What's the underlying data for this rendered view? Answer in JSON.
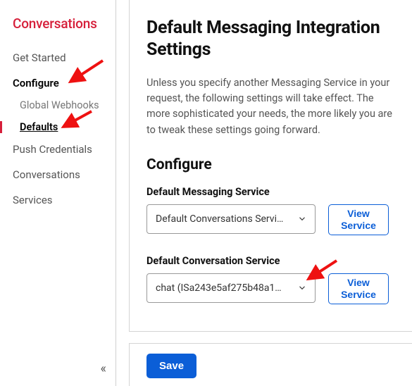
{
  "sidebar": {
    "title": "Conversations",
    "items": [
      {
        "label": "Get Started"
      },
      {
        "label": "Configure"
      },
      {
        "label": "Push Credentials"
      },
      {
        "label": "Conversations"
      },
      {
        "label": "Services"
      }
    ],
    "configure_sub": [
      {
        "label": "Global Webhooks"
      },
      {
        "label": "Defaults"
      }
    ]
  },
  "page": {
    "title": "Default Messaging Integration Settings",
    "description": "Unless you specify another Messaging Service in your request, the following settings will take effect. The more sophisticated your needs, the more likely you are to tweak these settings going forward.",
    "section_heading": "Configure"
  },
  "fields": {
    "messaging": {
      "label": "Default Messaging Service",
      "value": "Default Conversations Servi…",
      "view_label": "View Service"
    },
    "conversation": {
      "label": "Default Conversation Service",
      "value": "chat (ISa243e5af275b48a1…",
      "view_label": "View Service"
    }
  },
  "actions": {
    "save": "Save"
  },
  "collapse_glyph": "«"
}
